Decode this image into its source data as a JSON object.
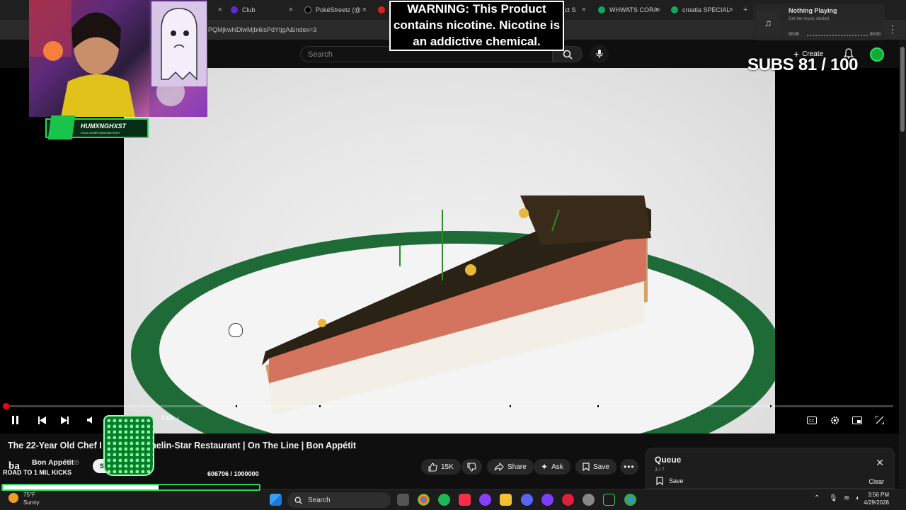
{
  "browser": {
    "tabs": [
      {
        "label": "Club",
        "fav_color": "#5b2bd9"
      },
      {
        "label": "PokéStreetz (@",
        "fav_color": "#000000"
      },
      {
        "label": "",
        "fav_color": "#e02020"
      },
      {
        "label": "ct S",
        "fav_color": "#3a3a3a"
      },
      {
        "label": "WHWATS CORA",
        "fav_color": "#1aa260"
      },
      {
        "label": "croatia SPECIAL",
        "fav_color": "#1aa260"
      }
    ],
    "url": "PQMjkwNDlwMjbi6isPdYtjgA&index=3"
  },
  "youtube": {
    "search_placeholder": "Search",
    "create_label": "Create",
    "video": {
      "title": "The 22-Year Old Chef I              Michelin-Star Restaurant | On The Line | Bon Appétit",
      "progress_fraction": 0.004,
      "chapter_label": "Intro",
      "timecode": "9"
    },
    "channel": {
      "logo": "ba",
      "name": "Bon Appétit",
      "verified": "◎",
      "subscribers": "",
      "subscribe_label": "S"
    },
    "actions": {
      "likes": "15K",
      "share": "Share",
      "ask": "Ask",
      "save": "Save"
    },
    "queue": {
      "title": "Queue",
      "count": "3 / 7",
      "save": "Save",
      "clear": "Clear"
    }
  },
  "overlays": {
    "warning": "WARNING: This Product contains nicotine. Nicotine is an addictive chemical.",
    "subs_goal": "SUBS 81 / 100",
    "streamer_name": "HUMXNGHXST",
    "streamer_sub": "KICK.COM/HUMXNGHXST",
    "kicks_label": "ROAD TO 1 MIL KICKS",
    "kicks_count": "606706 / 1000000",
    "kicks_fraction": 0.607,
    "spotify": {
      "title": "Nothing Playing",
      "subtitle": "Get the music started",
      "time_start": "00:00",
      "time_end": "00:00"
    }
  },
  "taskbar": {
    "weather_temp": "75°F",
    "weather_desc": "Sunny",
    "search_label": "Search",
    "time": "3:56 PM",
    "date": "4/29/2026"
  },
  "colors": {
    "accent_red": "#ff0000",
    "kick_green": "#2bd45b"
  }
}
